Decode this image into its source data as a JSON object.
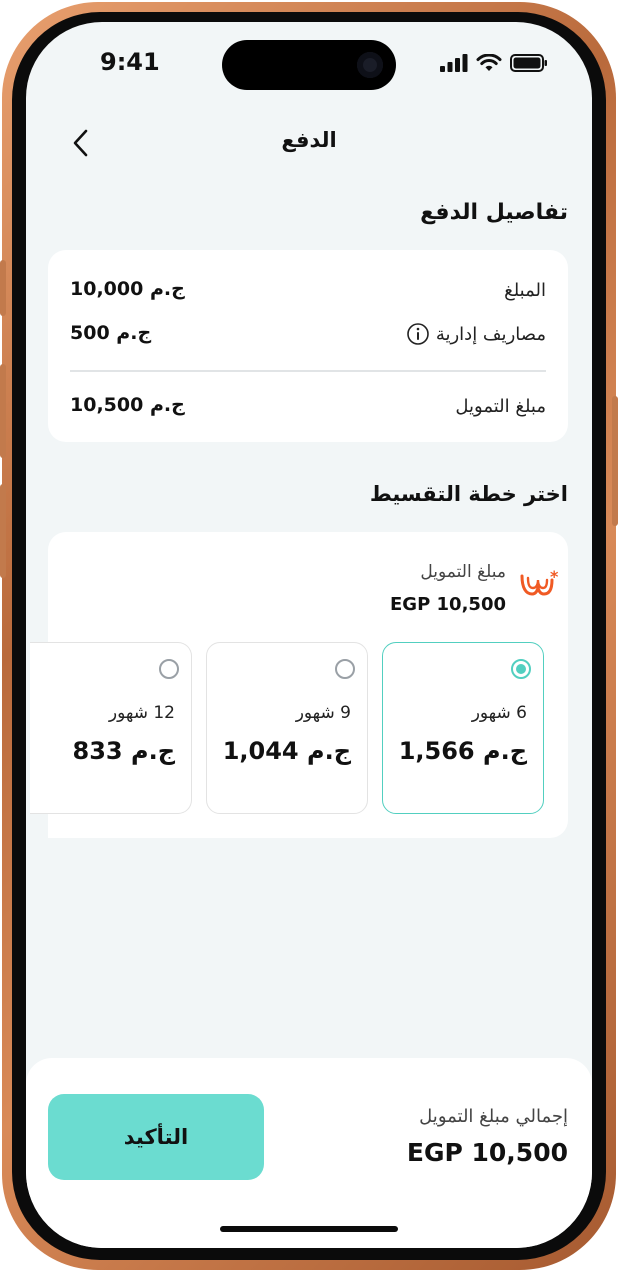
{
  "status_bar": {
    "time": "9:41"
  },
  "header": {
    "title": "الدفع"
  },
  "payment_details": {
    "title": "تفاصيل الدفع",
    "rows": [
      {
        "label": "المبلغ",
        "value": "10,000",
        "currency": "ج.م"
      },
      {
        "label": "مصاريف إدارية",
        "value": "500",
        "currency": "ج.م"
      },
      {
        "label": "مبلغ التمويل",
        "value": "10,500",
        "currency": "ج.م"
      }
    ]
  },
  "installment": {
    "title": "اختر خطة التقسيط",
    "financing_label": "مبلغ التمويل",
    "financing_amount": "EGP 10,500",
    "options": [
      {
        "months": "6 شهور",
        "amount": "1,566",
        "currency": "ج.م",
        "selected": true
      },
      {
        "months": "9 شهور",
        "amount": "1,044",
        "currency": "ج.م",
        "selected": false
      },
      {
        "months": "12 شهور",
        "amount": "833",
        "currency": "ج.م",
        "selected": false
      }
    ]
  },
  "footer": {
    "total_label": "إجمالي مبلغ التمويل",
    "total_amount": "EGP 10,500",
    "confirm_label": "التأكيد"
  },
  "colors": {
    "accent": "#6bdcd0",
    "selected_border": "#52cfc0",
    "brand_logo": "#f05a24",
    "frame": "#c27a4c"
  },
  "icons": [
    "back-chevron-icon",
    "info-icon",
    "provider-logo-icon",
    "signal-icon",
    "wifi-icon",
    "battery-icon"
  ]
}
